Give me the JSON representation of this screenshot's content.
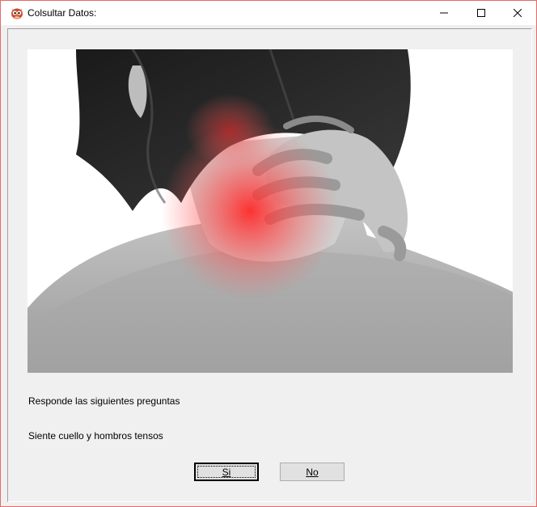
{
  "window": {
    "title": "Colsultar Datos:"
  },
  "titlebar": {
    "icons": {
      "app": "owl-app-icon",
      "minimize": "minimize-icon",
      "maximize": "maximize-icon",
      "close": "close-icon"
    }
  },
  "main": {
    "image": {
      "subject": "neck-pain-photo",
      "highlight_color": "#ff2a2a"
    },
    "prompt_text": "Responde las siguientes preguntas",
    "question_text": "Siente cuello y hombros tensos",
    "buttons": {
      "yes_label": "Si",
      "no_label": "No"
    }
  },
  "colors": {
    "window_border": "#e26b6b",
    "client_background": "#f0f0f0",
    "button_face": "#e1e1e1"
  }
}
